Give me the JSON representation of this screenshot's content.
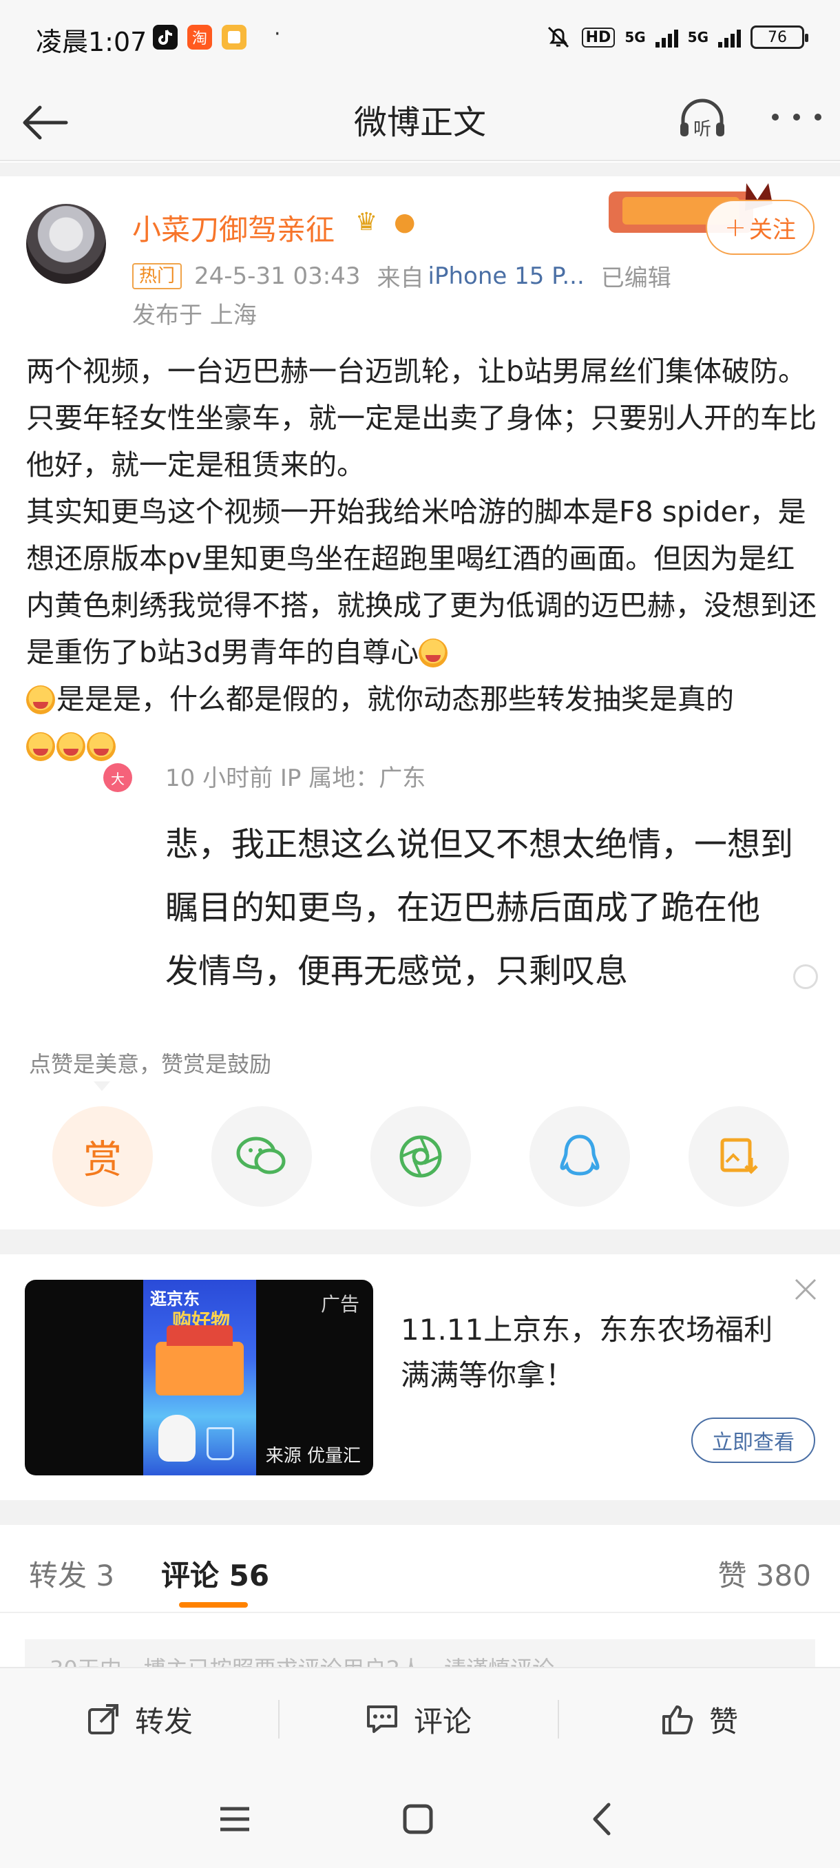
{
  "status_bar": {
    "time": "凌晨1:07",
    "dot": "·",
    "hd": "HD",
    "net1": "5G",
    "net2": "5G",
    "battery": "76"
  },
  "header": {
    "title": "微博正文"
  },
  "post": {
    "author": "小菜刀御驾亲征",
    "follow_label": "关注",
    "hot_badge": "热门",
    "date": "24-5-31 03:43",
    "from_label": "来自",
    "device": "iPhone 15 P...",
    "edited": "已编辑",
    "location": "发布于 上海",
    "body": [
      "两个视频，一台迈巴赫一台迈凯轮，让b站男屌丝们集体破防。只要年轻女性坐豪车，就一定是出卖了身体；只要别人开的车比他好，就一定是租赁来的。",
      "其实知更鸟这个视频一开始我给米哈游的脚本是F8 spider，是想还原版本pv里知更鸟坐在超跑里喝红酒的画面。但因为是红内黄色刺绣我觉得不搭，就换成了更为低调的迈巴赫，没想到还是重伤了b站3d男青年的自尊心",
      "是是是，什么都是假的，就你动态那些转发抽奖是真的"
    ]
  },
  "floating_comment": {
    "badge": "大",
    "meta": "10 小时前  IP 属地：广东",
    "lines": [
      "悲，我正想这么说但又不想太绝情，一想到",
      "瞩目的知更鸟，在迈巴赫后面成了跪在他",
      "发情鸟，便再无感觉，只剩叹息"
    ]
  },
  "reward": {
    "tip": "点赞是美意，赞赏是鼓励",
    "reward_label": "赏"
  },
  "ad": {
    "label": "广告",
    "source": "来源 优量汇",
    "art_title": "逛京东",
    "art_subtitle": "购好物",
    "text": "11.11上京东，东东农场福利满满等你拿！",
    "cta": "立即查看"
  },
  "tabs": {
    "repost": "转发 3",
    "comments": "评论 56",
    "likes": "赞 380"
  },
  "hint": "30天内，博主已按照要求评论用户2人，请谨慎评论",
  "actions": {
    "repost": "转发",
    "comment": "评论",
    "like": "赞"
  },
  "colors": {
    "accent": "#f7752a",
    "link": "#4a6fa5",
    "tab_indicator": "#ff8200"
  }
}
